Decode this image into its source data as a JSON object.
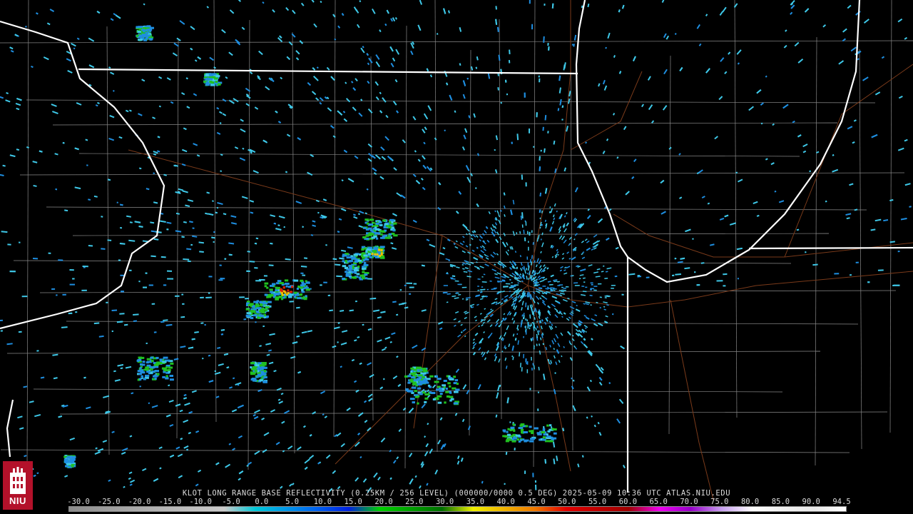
{
  "product_caption": "KLOT LONG RANGE BASE REFLECTIVITY (0.25KM / 256 LEVEL) (000000/0000 0.5 DEG) 2025-05-09 10:36 UTC  ATLAS.NIU.EDU",
  "radar_site": "KLOT",
  "scale": {
    "labels": [
      "-30.0",
      "-25.0",
      "-20.0",
      "-15.0",
      "-10.0",
      "-5.0",
      "0.0",
      "5.0",
      "10.0",
      "15.0",
      "20.0",
      "25.0",
      "30.0",
      "35.0",
      "40.0",
      "45.0",
      "50.0",
      "55.0",
      "60.0",
      "65.0",
      "70.0",
      "75.0",
      "80.0",
      "85.0",
      "90.0",
      "94.5"
    ],
    "colors": [
      "#8c8c8c",
      "#9a9a9a",
      "#a8a8a8",
      "#b4b4b4",
      "#c0c0c0",
      "#cccccc",
      "#00c8d8",
      "#0096e8",
      "#0060f0",
      "#0020e0",
      "#00d000",
      "#00a000",
      "#007000",
      "#f0f000",
      "#f0b400",
      "#f07800",
      "#e00000",
      "#c00000",
      "#a00000",
      "#f000f0",
      "#9600c8",
      "#c8a0f0",
      "#ffffff",
      "#f0f0f0",
      "#e8e8e8",
      "#ffffff"
    ]
  },
  "logo": {
    "text": "NIU",
    "color": "#b3112a"
  },
  "colors": {
    "state_lines": "#ffffff",
    "county_lines": "#8a8a8a",
    "roads": "#7a3a1a",
    "echo_light": "#3ec8e8",
    "echo_mid": "#1e8ee0",
    "echo_strong": "#20c020",
    "echo_heavy": "#f0c000",
    "echo_core": "#e02000"
  }
}
